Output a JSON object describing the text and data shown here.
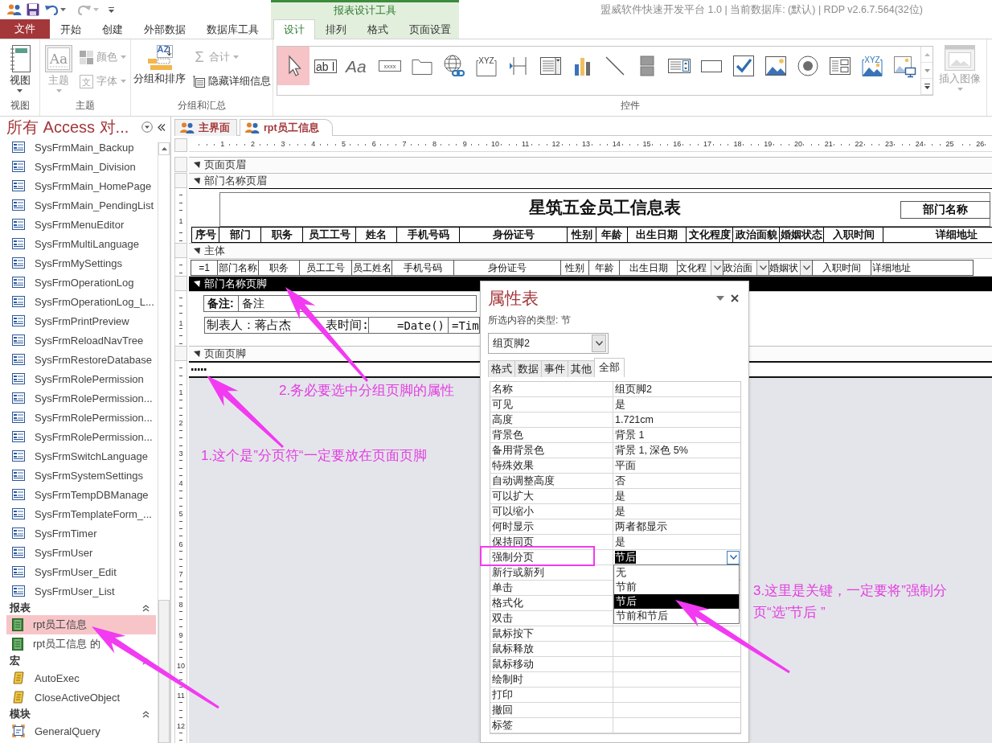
{
  "title_bar": {
    "text": "盟威软件快速开发平台 1.0 | 当前数据库: (默认) | RDP v2.6.7.564(32位)"
  },
  "ribbon": {
    "context_group": "报表设计工具",
    "tabs": [
      {
        "label": "文件",
        "kind": "file",
        "selected": false
      },
      {
        "label": "开始",
        "kind": "main",
        "selected": false
      },
      {
        "label": "创建",
        "kind": "main",
        "selected": false
      },
      {
        "label": "外部数据",
        "kind": "main",
        "selected": false
      },
      {
        "label": "数据库工具",
        "kind": "main",
        "selected": false
      },
      {
        "label": "设计",
        "kind": "context",
        "selected": true
      },
      {
        "label": "排列",
        "kind": "context",
        "selected": false
      },
      {
        "label": "格式",
        "kind": "context",
        "selected": false
      },
      {
        "label": "页面设置",
        "kind": "context",
        "selected": false
      }
    ],
    "groups": [
      {
        "kind": "view",
        "label": "视图",
        "buttons": [
          {
            "kind": "view",
            "label": "视图",
            "disabled": false,
            "dropdown": true
          }
        ]
      },
      {
        "kind": "theme",
        "label": "主题",
        "buttons": [
          {
            "kind": "themes",
            "label": "主题",
            "glyph": "Aa",
            "disabled": true,
            "dropdown": true
          },
          {
            "kind": "colors",
            "label": "颜色",
            "disabled": true,
            "dropdown": true
          },
          {
            "kind": "fonts",
            "label": "字体",
            "glyph": "文",
            "disabled": true,
            "dropdown": true
          }
        ]
      },
      {
        "kind": "grouping",
        "label": "分组和汇总",
        "buttons": [
          {
            "kind": "sort",
            "label": "分组和排序",
            "glyph": "AZ",
            "disabled": false,
            "dropdown": false
          },
          {
            "kind": "totals",
            "label": "合计",
            "glyph": "Σ",
            "disabled": true,
            "dropdown": true
          },
          {
            "kind": "hide",
            "label": "隐藏详细信息",
            "disabled": false,
            "dropdown": false
          }
        ]
      },
      {
        "kind": "controls",
        "label": "控件",
        "tools": [
          {
            "kind": "pointer",
            "selected": true
          },
          {
            "kind": "textbox",
            "glyph": "ab",
            "selected": false
          },
          {
            "kind": "label",
            "glyph": "Aa",
            "selected": false
          },
          {
            "kind": "button",
            "glyph": "xxxx",
            "selected": false
          },
          {
            "kind": "tab",
            "selected": false
          },
          {
            "kind": "hyperlink",
            "selected": false
          },
          {
            "kind": "option_group",
            "glyph": "XYZ",
            "selected": false
          },
          {
            "kind": "page_break",
            "selected": false
          },
          {
            "kind": "combo",
            "selected": false
          },
          {
            "kind": "chart",
            "selected": false
          },
          {
            "kind": "line",
            "selected": false
          },
          {
            "kind": "toggle",
            "selected": false
          },
          {
            "kind": "listbox",
            "selected": false
          },
          {
            "kind": "rectangle",
            "selected": false
          },
          {
            "kind": "checkbox",
            "selected": false
          },
          {
            "kind": "image",
            "selected": false
          },
          {
            "kind": "option",
            "selected": false
          },
          {
            "kind": "subform",
            "selected": false
          },
          {
            "kind": "bound_object",
            "glyph": "XYZ",
            "selected": false
          },
          {
            "kind": "unbound_object",
            "selected": false
          }
        ],
        "buttons": [
          {
            "kind": "insert_image",
            "label": "插入图像",
            "disabled": true,
            "dropdown": true
          }
        ]
      }
    ]
  },
  "nav_pane": {
    "title": "所有 Access 对...",
    "groups": [
      {
        "kind": "form",
        "items": [
          {
            "label": "SysFrmMain_Backup",
            "selected": false
          },
          {
            "label": "SysFrmMain_Division",
            "selected": false
          },
          {
            "label": "SysFrmMain_HomePage",
            "selected": false
          },
          {
            "label": "SysFrmMain_PendingList",
            "selected": false
          },
          {
            "label": "SysFrmMenuEditor",
            "selected": false
          },
          {
            "label": "SysFrmMultiLanguage",
            "selected": false
          },
          {
            "label": "SysFrmMySettings",
            "selected": false
          },
          {
            "label": "SysFrmOperationLog",
            "selected": false
          },
          {
            "label": "SysFrmOperationLog_L...",
            "selected": false
          },
          {
            "label": "SysFrmPrintPreview",
            "selected": false
          },
          {
            "label": "SysFrmReloadNavTree",
            "selected": false
          },
          {
            "label": "SysFrmRestoreDatabase",
            "selected": false
          },
          {
            "label": "SysFrmRolePermission",
            "selected": false
          },
          {
            "label": "SysFrmRolePermission...",
            "selected": false
          },
          {
            "label": "SysFrmRolePermission...",
            "selected": false
          },
          {
            "label": "SysFrmRolePermission...",
            "selected": false
          },
          {
            "label": "SysFrmSwitchLanguage",
            "selected": false
          },
          {
            "label": "SysFrmSystemSettings",
            "selected": false
          },
          {
            "label": "SysFrmTempDBManage",
            "selected": false
          },
          {
            "label": "SysFrmTemplateForm_...",
            "selected": false
          },
          {
            "label": "SysFrmTimer",
            "selected": false
          },
          {
            "label": "SysFrmUser",
            "selected": false
          },
          {
            "label": "SysFrmUser_Edit",
            "selected": false
          },
          {
            "label": "SysFrmUser_List",
            "selected": false
          }
        ]
      },
      {
        "kind": "report",
        "label": "报表",
        "expanded": true,
        "items": [
          {
            "label": "rpt员工信息",
            "selected": true
          },
          {
            "label": "rpt员工信息 的",
            "selected": false
          }
        ]
      },
      {
        "kind": "macro",
        "label": "宏",
        "expanded": true,
        "items": [
          {
            "label": "AutoExec",
            "selected": false
          },
          {
            "label": "CloseActiveObject",
            "selected": false
          }
        ]
      },
      {
        "kind": "module",
        "label": "模块",
        "expanded": true,
        "items": [
          {
            "label": "GeneralQuery",
            "selected": false
          }
        ]
      }
    ]
  },
  "document_tabs": [
    {
      "label": "主界面",
      "selected": false
    },
    {
      "label": "rpt员工信息",
      "selected": true
    }
  ],
  "report_design": {
    "ruler_marks": [
      "1",
      "2",
      "3",
      "4",
      "5",
      "6",
      "7",
      "8",
      "9",
      "10",
      "11",
      "12",
      "13",
      "14",
      "15",
      "16",
      "17",
      "18",
      "19",
      "20",
      "21",
      "22",
      "23",
      "24",
      "25",
      "26"
    ],
    "sections": [
      {
        "kind": "page_header",
        "bar": "页面页眉",
        "selected": false
      },
      {
        "kind": "group_header",
        "bar": "部门名称页眉",
        "selected": false,
        "ruler_marks": [
          "1"
        ],
        "title": "星筑五金员工信息表",
        "group_field": "部门名称",
        "columns": [
          "序号",
          "部门",
          "职务",
          "员工工号",
          "姓名",
          "手机号码",
          "身份证号",
          "性别",
          "年龄",
          "出生日期",
          "文化程度",
          "政治面貌",
          "婚姻状态",
          "入职时间",
          "详细地址"
        ]
      },
      {
        "kind": "detail",
        "bar": "主体",
        "selected": false,
        "fields": [
          {
            "text": "=1",
            "kind": "textbox"
          },
          {
            "text": "部门名称",
            "kind": "textbox"
          },
          {
            "text": "职务",
            "kind": "textbox"
          },
          {
            "text": "员工工号",
            "kind": "textbox"
          },
          {
            "text": "员工姓名",
            "kind": "textbox"
          },
          {
            "text": "手机号码",
            "kind": "textbox"
          },
          {
            "text": "身份证号",
            "kind": "textbox"
          },
          {
            "text": "性别",
            "kind": "textbox"
          },
          {
            "text": "年龄",
            "kind": "textbox"
          },
          {
            "text": "出生日期",
            "kind": "textbox"
          },
          {
            "text": "文化程",
            "kind": "combo"
          },
          {
            "text": "政治面",
            "kind": "combo"
          },
          {
            "text": "婚姻状",
            "kind": "combo"
          },
          {
            "text": "入职时间",
            "kind": "textbox"
          },
          {
            "text": "详细地址",
            "kind": "textbox"
          }
        ]
      },
      {
        "kind": "group_footer",
        "bar": "部门名称页脚",
        "selected": true,
        "ruler_marks": [
          "1"
        ],
        "remark_label": "备注:",
        "remark_value": "备注",
        "maker": "制表人：蒋占杰",
        "time_label": "表时间:",
        "date_expr": "=Date()",
        "time_expr": "=Tim"
      },
      {
        "kind": "page_footer",
        "bar": "页面页脚",
        "selected": false,
        "page_break": true
      }
    ],
    "canvas_ruler_marks": [
      "1",
      "2",
      "3",
      "4",
      "5",
      "6",
      "7",
      "8",
      "9",
      "10",
      "11",
      "12"
    ]
  },
  "property_sheet": {
    "title": "属性表",
    "selection_type": "所选内容的类型: 节",
    "object": "组页脚2",
    "tabs": [
      {
        "label": "格式",
        "selected": false
      },
      {
        "label": "数据",
        "selected": false
      },
      {
        "label": "事件",
        "selected": false
      },
      {
        "label": "其他",
        "selected": false
      },
      {
        "label": "全部",
        "selected": true
      }
    ],
    "rows": [
      {
        "name": "名称",
        "value": "组页脚2"
      },
      {
        "name": "可见",
        "value": "是"
      },
      {
        "name": "高度",
        "value": "1.721cm"
      },
      {
        "name": "背景色",
        "value": "背景 1"
      },
      {
        "name": "备用背景色",
        "value": "背景 1, 深色 5%"
      },
      {
        "name": "特殊效果",
        "value": "平面"
      },
      {
        "name": "自动调整高度",
        "value": "否"
      },
      {
        "name": "可以扩大",
        "value": "是"
      },
      {
        "name": "可以缩小",
        "value": "是"
      },
      {
        "name": "何时显示",
        "value": "两者都显示"
      },
      {
        "name": "保持同页",
        "value": "是"
      },
      {
        "name": "强制分页",
        "value": "节后",
        "kind": "combo",
        "options": [
          {
            "label": "无",
            "selected": false
          },
          {
            "label": "节前",
            "selected": false
          },
          {
            "label": "节后",
            "selected": true
          },
          {
            "label": "节前和节后",
            "selected": false
          }
        ]
      },
      {
        "name": "新行或新列"
      },
      {
        "name": "单击"
      },
      {
        "name": "格式化"
      },
      {
        "name": "双击"
      },
      {
        "name": "鼠标按下"
      },
      {
        "name": "鼠标释放"
      },
      {
        "name": "鼠标移动"
      },
      {
        "name": "绘制时"
      },
      {
        "name": "打印"
      },
      {
        "name": "撤回"
      },
      {
        "name": "标签"
      }
    ]
  },
  "annotations": [
    {
      "text": "2.务必要选中分组页脚的属性"
    },
    {
      "text": "1.这个是”分页符“一定要放在页面页脚"
    },
    {
      "text": "3.这里是关键，一定要将”强制分页“选”节后 ”"
    }
  ]
}
